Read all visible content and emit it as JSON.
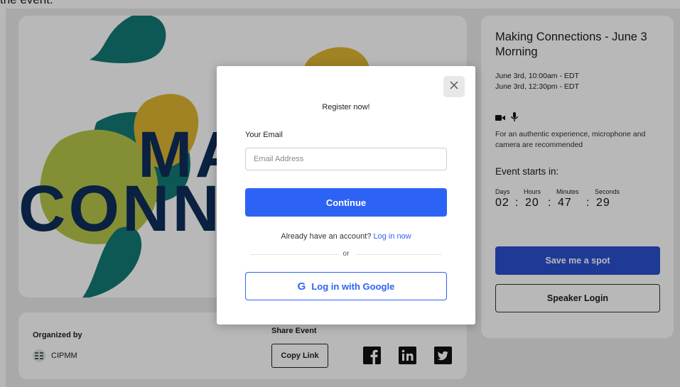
{
  "page": {
    "cutoff_text": "the event."
  },
  "hero": {
    "title_line1": "MA",
    "title_line2": "CONN",
    "colors": {
      "teal": "#137a77",
      "yellow_green": "#b7c64a",
      "mustard": "#e0b633",
      "navy": "#0f2f5b"
    }
  },
  "event": {
    "title": "Making Connections - June 3 Morning",
    "start_date": "June 3rd, 10:00am - EDT",
    "end_date": "June 3rd, 12:30pm - EDT",
    "icons": [
      "video-camera-icon",
      "microphone-icon"
    ],
    "recommendation": "For an authentic experience, microphone and camera are recommended",
    "starts_in_label": "Event starts in:",
    "countdown": {
      "labels": {
        "days": "Days",
        "hours": "Hours",
        "minutes": "Minutes",
        "seconds": "Seconds"
      },
      "values": {
        "days": "02",
        "hours": "20",
        "minutes": "47",
        "seconds": "29"
      },
      "sep1": ":",
      "sep2": ":",
      "sep3": ":"
    },
    "save_spot_label": "Save me a spot",
    "speaker_login_label": "Speaker Login",
    "accent_color": "#2b4fd0"
  },
  "organizer": {
    "label": "Organized by",
    "name": "CIPMM"
  },
  "share": {
    "label": "Share Event",
    "copy_link_label": "Copy Link",
    "icons": [
      "facebook-icon",
      "linkedin-icon",
      "twitter-icon"
    ]
  },
  "modal": {
    "close_icon": "close-icon",
    "heading": "Register now!",
    "email_label": "Your Email",
    "email_placeholder": "Email Address",
    "email_value": "",
    "continue_label": "Continue",
    "account_prompt": "Already have an account?",
    "login_link": "Log in now",
    "or_text": "or",
    "google_icon_text": "G",
    "google_label": "Log in with Google",
    "primary_color": "#2d63f5"
  }
}
